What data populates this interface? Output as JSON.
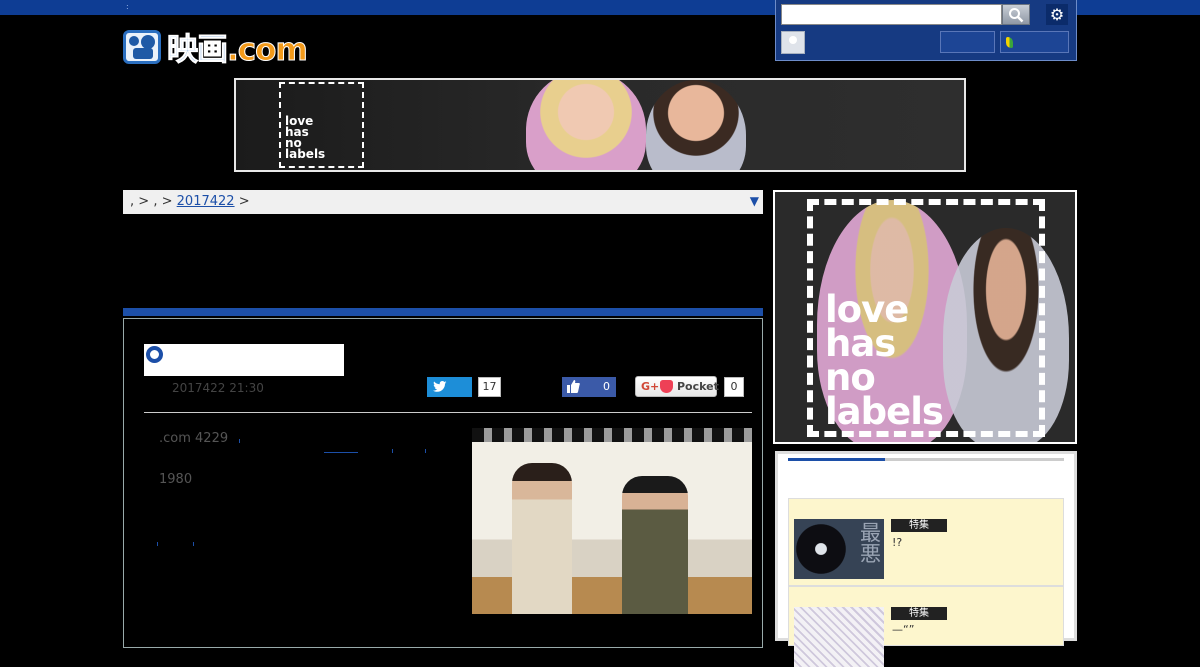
{
  "topbar": {
    "dot": ":"
  },
  "logo": {
    "text_main": "映画",
    "text_suffix": ".com"
  },
  "userpanel": {
    "search_value": "",
    "gear_symbol": "⚙",
    "login_label": "",
    "register_label": ""
  },
  "banner": {
    "text": [
      "love",
      "has",
      "no",
      "labels"
    ]
  },
  "breadcrumb": {
    "sep1": ",",
    "arrow1": ">",
    "sep2": ",",
    "arrow2": ">",
    "date_link": "2017422",
    "arrow3": ">",
    "toggle": "▼"
  },
  "article": {
    "title": "",
    "date": "2017422 21:30",
    "twitter_count": "17",
    "facebook_count": "0",
    "pocket_label": "Pocket",
    "pocket_google": "G+",
    "pocket_count": "0",
    "paragraph1": ".com            4229",
    "paragraph2": "1980"
  },
  "sidead": {
    "text": [
      "love",
      "has",
      "no",
      "labels"
    ]
  },
  "featured": {
    "cards": [
      {
        "badge": "特集",
        "title": "!?",
        "thumb_text": "最\n悪"
      },
      {
        "badge": "特集",
        "title": "—“”"
      }
    ]
  },
  "colors": {
    "brand_blue": "#1c4fa8",
    "topbar_blue": "#0e3d94",
    "card_bg": "#fdf6cd"
  }
}
